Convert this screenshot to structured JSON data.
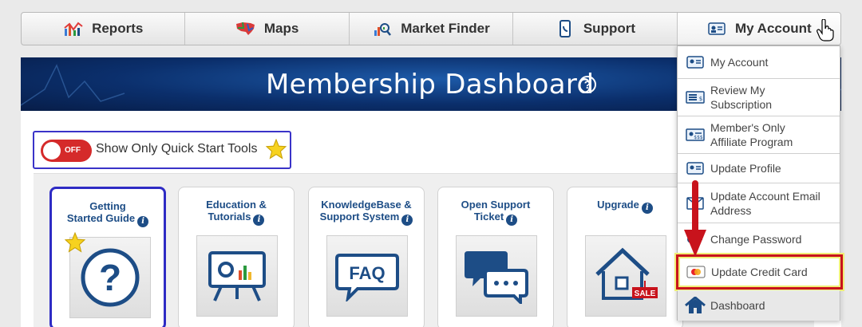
{
  "nav": {
    "items": [
      {
        "label": "Reports",
        "icon": "reports-chart-icon"
      },
      {
        "label": "Maps",
        "icon": "usa-map-icon"
      },
      {
        "label": "Market Finder",
        "icon": "market-finder-icon"
      },
      {
        "label": "Support",
        "icon": "phone-icon"
      },
      {
        "label": "My Account",
        "icon": "id-card-icon"
      }
    ]
  },
  "banner": {
    "title": "Membership Dashboard",
    "help_icon": "question-circle-icon"
  },
  "quick_start": {
    "toggle_state": "OFF",
    "label": "Show Only Quick Start Tools",
    "icon": "star-icon"
  },
  "tiles": [
    {
      "title_line1": "Getting",
      "title_line2": "Started Guide",
      "info": "i",
      "icon": "question-mark-icon",
      "selected": true,
      "star": true
    },
    {
      "title_line1": "Education &",
      "title_line2": "Tutorials",
      "info": "i",
      "icon": "presentation-board-icon"
    },
    {
      "title_line1": "KnowledgeBase &",
      "title_line2": "Support System",
      "info": "i",
      "icon": "faq-bubble-icon"
    },
    {
      "title_line1": "Open Support",
      "title_line2": "Ticket",
      "info": "i",
      "icon": "chat-bubbles-icon"
    },
    {
      "title_line1": "Upgrade",
      "title_line2": "",
      "info": "i",
      "icon": "house-sale-icon"
    }
  ],
  "dropdown": {
    "items": [
      {
        "label": "My Account",
        "icon": "id-card-icon"
      },
      {
        "label": "Review My Subscription",
        "icon": "subscription-list-icon"
      },
      {
        "label": "Member's Only Affiliate Program",
        "icon": "affiliate-card-icon"
      },
      {
        "label": "Update Profile",
        "icon": "id-card-icon"
      },
      {
        "label": "Update Account Email Address",
        "icon": "email-icon"
      },
      {
        "label": "Change Password",
        "icon": "key-icon"
      },
      {
        "label": "Update Credit Card",
        "icon": "credit-card-icon",
        "highlighted": true
      },
      {
        "label": "Dashboard",
        "icon": "house-icon"
      }
    ]
  },
  "colors": {
    "accent": "#1d4d86",
    "highlight_border": "#c8131c",
    "highlight_glow": "#f0ee76",
    "toggle_off": "#d52a2a",
    "selected_border": "#2e2bc4"
  }
}
